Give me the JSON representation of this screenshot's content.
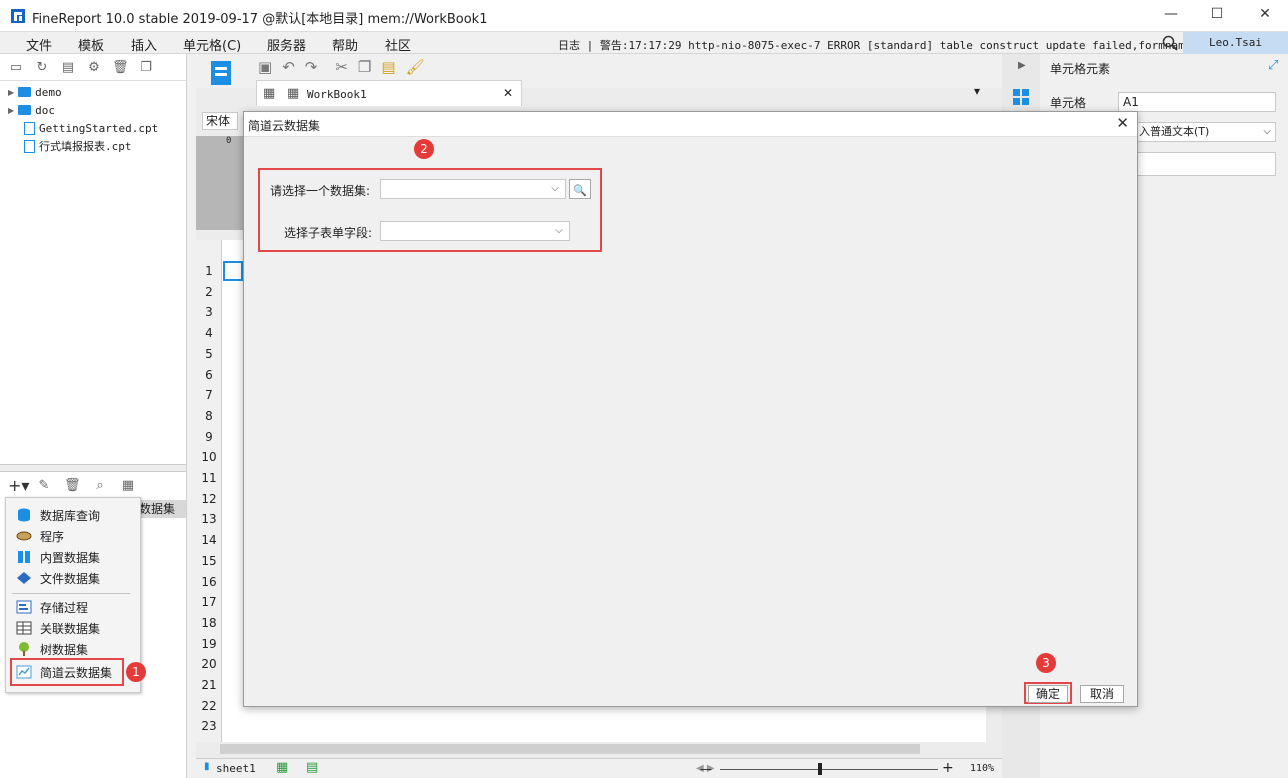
{
  "window": {
    "title": "FineReport 10.0 stable 2019-09-17 @默认[本地目录]    mem://WorkBook1",
    "minimize": "—",
    "maximize": "☐",
    "close": "✕"
  },
  "menu": {
    "items": [
      "文件",
      "模板",
      "插入",
      "单元格(C)",
      "服务器",
      "帮助",
      "社区"
    ],
    "log": "日志 | 警告:17:17:29 http-nio-8075-exec-7 ERROR [standard] table construct update failed,formname...",
    "user": "Leo.Tsai"
  },
  "tree": [
    {
      "type": "folder",
      "label": "demo"
    },
    {
      "type": "folder",
      "label": "doc"
    },
    {
      "type": "file",
      "label": "GettingStarted.cpt"
    },
    {
      "type": "file",
      "label": "行式填报报表.cpt"
    }
  ],
  "dataset_tab_fragment": "数据集",
  "popup": {
    "items": [
      {
        "label": "数据库查询",
        "icon": "database-icon",
        "color": "#1c8fe5"
      },
      {
        "label": "程序",
        "icon": "program-icon",
        "color": "#b8893a"
      },
      {
        "label": "内置数据集",
        "icon": "builtin-dataset-icon",
        "color": "#1c8fe5"
      },
      {
        "label": "文件数据集",
        "icon": "file-dataset-icon",
        "color": "#2b6cc4"
      },
      {
        "label": "存储过程",
        "icon": "stored-procedure-icon",
        "color": "#2b6cc4"
      },
      {
        "label": "关联数据集",
        "icon": "join-dataset-icon",
        "color": "#444"
      },
      {
        "label": "树数据集",
        "icon": "tree-dataset-icon",
        "color": "#7dbb2c"
      },
      {
        "label": "简道云数据集",
        "icon": "jiandaoyun-icon",
        "color": "#4b9ed6"
      }
    ]
  },
  "badges": [
    "1",
    "2",
    "3"
  ],
  "editor": {
    "tab": "WorkBook1",
    "font": "宋体",
    "sheet": "sheet1",
    "zoom": "110%",
    "rows": [
      "1",
      "2",
      "3",
      "4",
      "5",
      "6",
      "7",
      "8",
      "9",
      "10",
      "11",
      "12",
      "13",
      "14",
      "15",
      "16",
      "17",
      "18",
      "19",
      "20",
      "21",
      "22",
      "23"
    ],
    "ruler_zero": "0"
  },
  "right": {
    "header": "单元格元素",
    "cell_label": "单元格",
    "cell_value": "A1",
    "insert_type": "入普通文本(T)"
  },
  "dialog": {
    "title": "简道云数据集",
    "dataset_label": "请选择一个数据集:",
    "dataset_value": "",
    "subfield_label": "选择子表单字段:",
    "subfield_value": "",
    "ok": "确定",
    "cancel": "取消"
  }
}
